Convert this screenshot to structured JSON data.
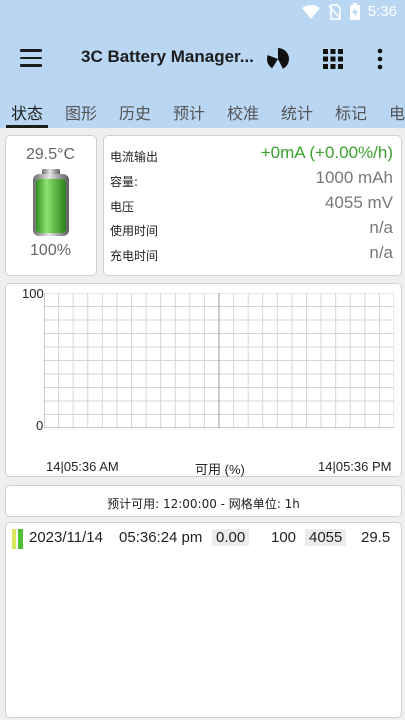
{
  "status_bar": {
    "time": "5:36"
  },
  "app_bar": {
    "title": "3C Battery Manager..."
  },
  "tabs": [
    "状态",
    "图形",
    "历史",
    "预计",
    "校准",
    "统计",
    "标记",
    "电"
  ],
  "battery": {
    "temperature": "29.5°C",
    "level_percent": 100,
    "level_text": "100%"
  },
  "info": [
    {
      "label": "电流输出",
      "value": "+0mA (+0.00%/h)",
      "color": "#3aa22d"
    },
    {
      "label": "容量:",
      "value": "1000 mAh"
    },
    {
      "label": "电压",
      "value": "4055 mV"
    },
    {
      "label": "使用时间",
      "value": "n/a"
    },
    {
      "label": "充电时间",
      "value": "n/a"
    }
  ],
  "chart_data": {
    "type": "line",
    "y_tick_labels": [
      "100",
      "0"
    ],
    "ylim": [
      0,
      100
    ],
    "x_start_label": "14|05:36 AM",
    "x_end_label": "14|05:36 PM",
    "xlabel": "可用 (%)",
    "series": [],
    "grid": true
  },
  "prediction": {
    "text": "预计可用:  12:00:00 - 网格单位:  1h"
  },
  "log": {
    "entries": [
      {
        "date": "2023/11/14",
        "time": "05:36:24 pm",
        "rate": "0.00",
        "level": "100",
        "voltage": "4055",
        "temp": "29.5"
      }
    ]
  },
  "colors": {
    "accent": "#b9d6f2",
    "positive": "#3aa22d",
    "battery_green": "#4cc234"
  }
}
